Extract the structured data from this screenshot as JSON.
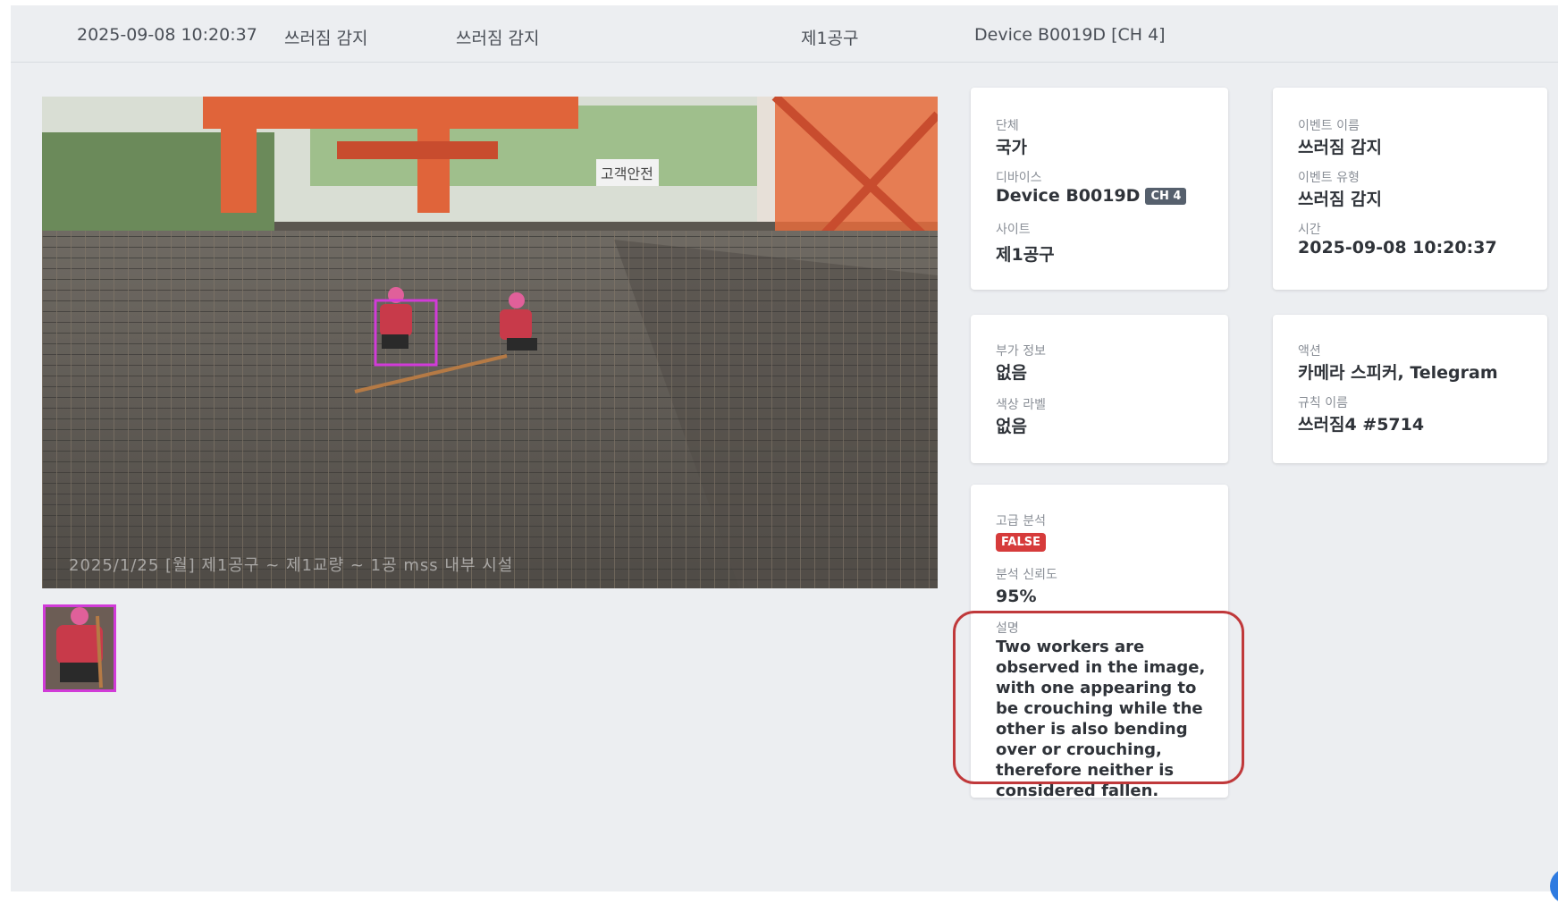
{
  "header": {
    "datetime": "2025-09-08 10:20:37",
    "event_name": "쓰러짐 감지",
    "event_type": "쓰러짐 감지",
    "site": "제1공구",
    "device": "Device B0019D [CH 4]"
  },
  "camera": {
    "osd_text": "2025/1/25 [월] 제1공구 ~ 제1교량 ~ 1공 mss 내부 시설",
    "sign_text": "고객안전",
    "detections": 1
  },
  "cards": {
    "org_label": "단체",
    "org_value": "국가",
    "device_label": "디바이스",
    "device_value": "Device B0019D",
    "device_channel": "CH 4",
    "site_label": "사이트",
    "site_value": "제1공구",
    "event_name_label": "이벤트 이름",
    "event_name_value": "쓰러짐 감지",
    "event_type_label": "이벤트 유형",
    "event_type_value": "쓰러짐 감지",
    "time_label": "시간",
    "time_value": "2025-09-08 10:20:37",
    "extra_label": "부가 정보",
    "extra_value": "없음",
    "color_label": "색상 라벨",
    "color_value": "없음",
    "action_label": "액션",
    "action_value": "카메라 스피커, Telegram",
    "rule_label": "규칙 이름",
    "rule_value": "쓰러짐4 #5714",
    "analysis_label": "고급 분석",
    "analysis_value": "FALSE",
    "confidence_label": "분석 신뢰도",
    "confidence_value": "95%",
    "desc_label": "설명",
    "desc_value": "Two workers are observed in the image, with one appearing to be crouching while the other is also bending over or crouching, therefore neither is considered fallen."
  },
  "colors": {
    "detection_box": "#d13bd8",
    "false_badge": "#d63b3b",
    "highlight": "#c0393b"
  }
}
